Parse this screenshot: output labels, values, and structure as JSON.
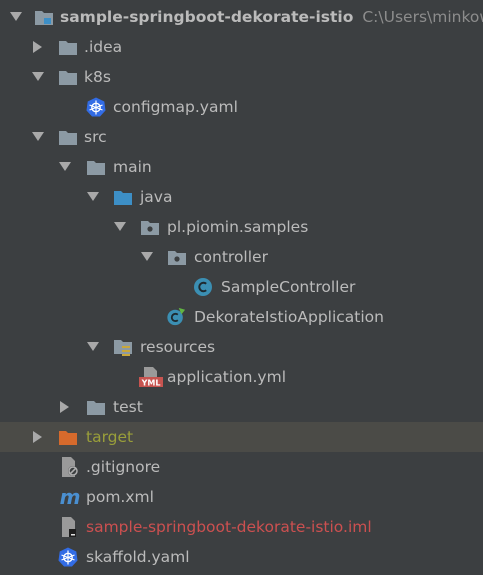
{
  "project_tree": {
    "root": {
      "name": "sample-springboot-dekorate-istio",
      "path": "C:\\Users\\minkow"
    },
    "idea": "idea",
    "k8s": "k8s",
    "configmap": "configmap.yaml",
    "src": "src",
    "main": "main",
    "java": "java",
    "package": "pl.piomin.samples",
    "controller": "controller",
    "sample_controller": "SampleController",
    "application_class": "DekorateIstioApplication",
    "resources": "resources",
    "application_yml": "application.yml",
    "test": "test",
    "target": "target",
    "gitignore": ".gitignore",
    "pom": "pom.xml",
    "iml": "sample-springboot-dekorate-istio.iml",
    "skaffold": "skaffold.yaml"
  },
  "colors": {
    "background": "#3c3f41",
    "text": "#bbbbbb",
    "selected_row": "#4b4b47",
    "excluded_text": "#9a9f3a",
    "ignored_text": "#cc5050",
    "folder": "#8c9aa4",
    "source_folder": "#3d8fc6",
    "target_folder": "#d66a2c",
    "kubernetes": "#326ce5",
    "class_icon": "#3b8fb3"
  },
  "icons": {
    "root": "module-folder-icon",
    "kubernetes": "kubernetes-icon",
    "class": "java-class-icon",
    "spring_boot_app": "spring-boot-application-icon",
    "yaml": "yml-file-icon",
    "ignore": "ignore-file-icon",
    "maven": "maven-icon",
    "iml": "iml-file-icon"
  }
}
